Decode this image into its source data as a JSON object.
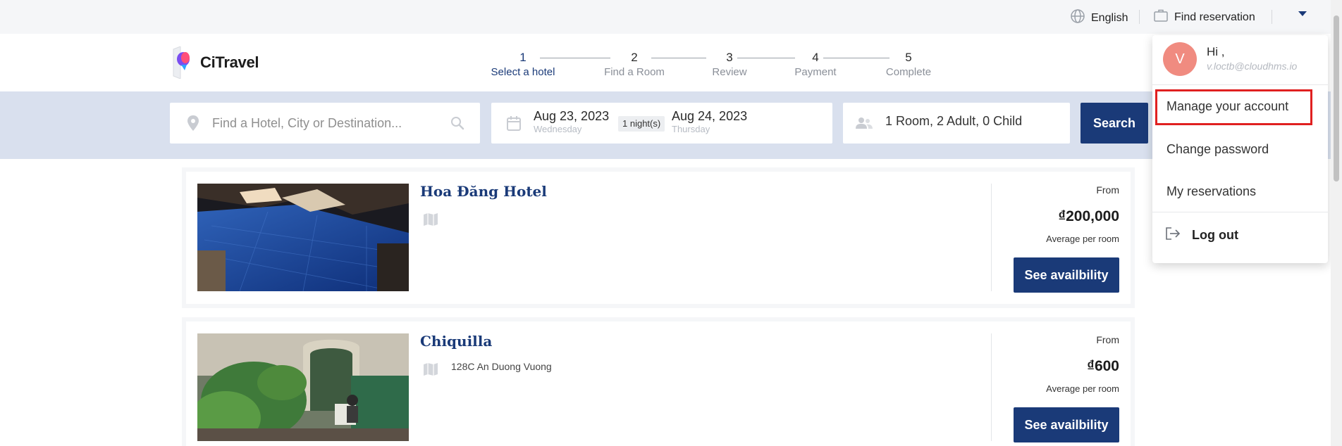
{
  "topbar": {
    "language_label": "English",
    "find_reservation_label": "Find reservation"
  },
  "brand": {
    "name": "CiTravel"
  },
  "steps": [
    {
      "number": "1",
      "label": "Select a hotel"
    },
    {
      "number": "2",
      "label": "Find a Room"
    },
    {
      "number": "3",
      "label": "Review"
    },
    {
      "number": "4",
      "label": "Payment"
    },
    {
      "number": "5",
      "label": "Complete"
    }
  ],
  "search": {
    "destination_placeholder": "Find a Hotel, City or Destination...",
    "checkin_date": "Aug 23, 2023",
    "checkin_day": "Wednesday",
    "nights": "1 night(s)",
    "checkout_date": "Aug 24, 2023",
    "checkout_day": "Thursday",
    "guests": "1 Room, 2 Adult, 0 Child",
    "button_label": "Search"
  },
  "hotels": [
    {
      "name": "Hoa Đăng Hotel",
      "address": "",
      "price_from_label": "From",
      "price": "₫200,000",
      "price_note": "Average per room",
      "button_label": "See availbility"
    },
    {
      "name": "Chiquilla",
      "address": "128C An Duong Vuong",
      "price_from_label": "From",
      "price": "₫600",
      "price_note": "Average per room",
      "button_label": "See availbility"
    }
  ],
  "account_menu": {
    "avatar_initial": "V",
    "greeting": "Hi ,",
    "email": "v.loctb@cloudhms.io",
    "items": [
      {
        "label": "Manage your account"
      },
      {
        "label": "Change password"
      },
      {
        "label": "My reservations"
      }
    ],
    "logout_label": "Log out"
  },
  "colors": {
    "primary": "#1a3a78",
    "search_band": "#d9e0ee",
    "avatar": "#f08b80",
    "highlight": "#e02020"
  }
}
